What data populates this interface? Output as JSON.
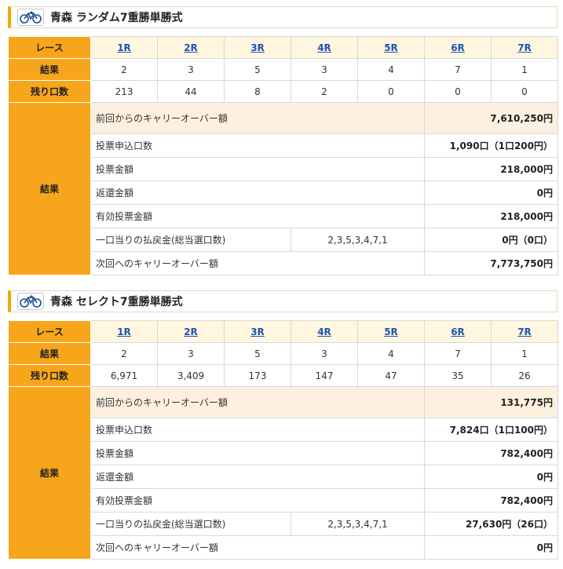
{
  "sections": [
    {
      "title": "青森 ランダム7重勝単勝式",
      "row_labels": {
        "race": "レース",
        "result": "結果",
        "remaining": "残り口数",
        "summary": "結果"
      },
      "races": [
        "1R",
        "2R",
        "3R",
        "4R",
        "5R",
        "6R",
        "7R"
      ],
      "results": [
        "2",
        "3",
        "5",
        "3",
        "4",
        "7",
        "1"
      ],
      "remaining": [
        "213",
        "44",
        "8",
        "2",
        "0",
        "0",
        "0"
      ],
      "carryover_in_label": "前回からのキャリーオーバー額",
      "carryover_in": "7,610,250円",
      "tickets_label": "投票申込口数",
      "tickets": "1,090口（1口200円）",
      "amount_label": "投票金額",
      "amount": "218,000円",
      "refund_label": "返還金額",
      "refund": "0円",
      "valid_label": "有効投票金額",
      "valid": "218,000円",
      "payout_label": "一口当りの払戻金(総当選口数)",
      "combo": "2,3,5,3,4,7,1",
      "payout": "0円（0口）",
      "carryover_out_label": "次回へのキャリーオーバー額",
      "carryover_out": "7,773,750円"
    },
    {
      "title": "青森 セレクト7重勝単勝式",
      "row_labels": {
        "race": "レース",
        "result": "結果",
        "remaining": "残り口数",
        "summary": "結果"
      },
      "races": [
        "1R",
        "2R",
        "3R",
        "4R",
        "5R",
        "6R",
        "7R"
      ],
      "results": [
        "2",
        "3",
        "5",
        "3",
        "4",
        "7",
        "1"
      ],
      "remaining": [
        "6,971",
        "3,409",
        "173",
        "147",
        "47",
        "35",
        "26"
      ],
      "carryover_in_label": "前回からのキャリーオーバー額",
      "carryover_in": "131,775円",
      "tickets_label": "投票申込口数",
      "tickets": "7,824口（1口100円）",
      "amount_label": "投票金額",
      "amount": "782,400円",
      "refund_label": "返還金額",
      "refund": "0円",
      "valid_label": "有効投票金額",
      "valid": "782,400円",
      "payout_label": "一口当りの払戻金(総当選口数)",
      "combo": "2,3,5,3,4,7,1",
      "payout": "27,630円（26口）",
      "carryover_out_label": "次回へのキャリーオーバー額",
      "carryover_out": "0円"
    }
  ],
  "icon": "bicycle-icon",
  "colors": {
    "accent": "#f7a51b",
    "header_bg": "#fff6e0",
    "link": "#1f53b4",
    "highlight": "#fdf0e0"
  }
}
